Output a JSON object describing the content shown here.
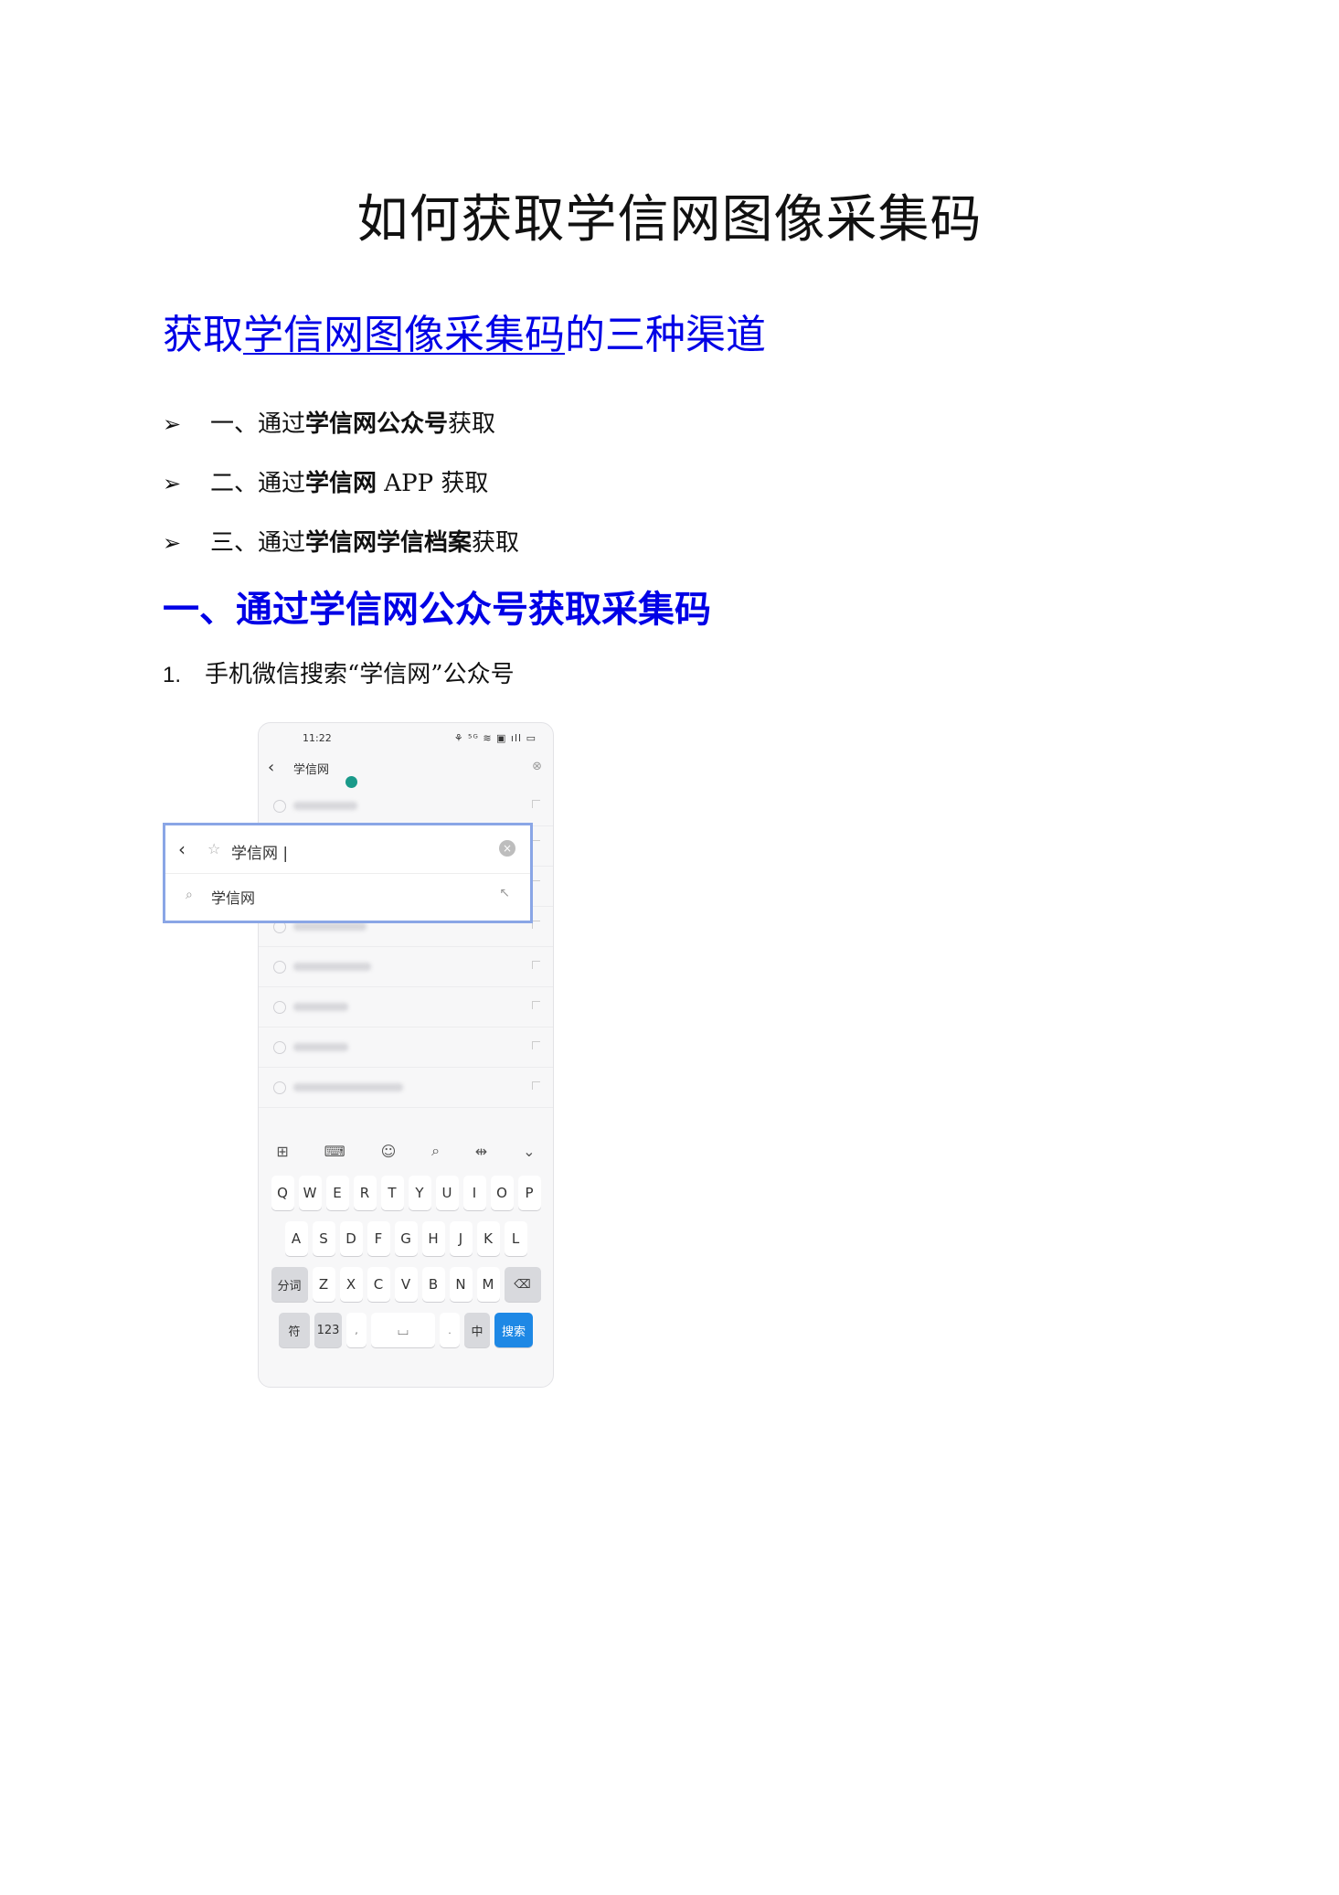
{
  "document": {
    "title": "如何获取学信网图像采集码",
    "section_heading": {
      "part1": "获取",
      "part2_underlined": "学信网图像采集码",
      "part3": "的三种渠道"
    },
    "channels": [
      {
        "prefix": "一、通过",
        "bold": "学信网公众号",
        "suffix": "获取"
      },
      {
        "prefix": "二、通过",
        "bold": "学信网",
        "suffix": " APP 获取"
      },
      {
        "prefix": "三、通过",
        "bold": "学信网学信档案",
        "suffix": "获取"
      }
    ],
    "subsection_heading": "一、通过学信网公众号获取采集码",
    "step1": {
      "number": "1.",
      "text": "手机微信搜索“学信网”公众号"
    },
    "bullet_symbol": "➢",
    "heading_color": "#0000e6"
  },
  "phone_screenshot": {
    "status_time": "11:22",
    "status_icons": "⚘ ⁵ᴳ ≋ ▣ ıll ▭",
    "search_query": "学信网",
    "overlay": {
      "back": "‹",
      "star": "☆",
      "query": "学信网 |",
      "clear": "×",
      "search_icon": "⌕",
      "suggestion": "学信网",
      "fill_icon": "↖"
    },
    "keyboard": {
      "row1": [
        "Q",
        "W",
        "E",
        "R",
        "T",
        "Y",
        "U",
        "I",
        "O",
        "P"
      ],
      "row2": [
        "A",
        "S",
        "D",
        "F",
        "G",
        "H",
        "J",
        "K",
        "L"
      ],
      "row3_left": "分词",
      "row3": [
        "Z",
        "X",
        "C",
        "V",
        "B",
        "N",
        "M"
      ],
      "row3_right": "⌫",
      "row4": [
        "符",
        "123",
        ",",
        "⌴",
        ".",
        "中",
        "搜索"
      ]
    },
    "toolbar_icons": [
      "⊞",
      "⌨",
      "☺",
      "⌕",
      "⇹",
      "⌄"
    ]
  }
}
